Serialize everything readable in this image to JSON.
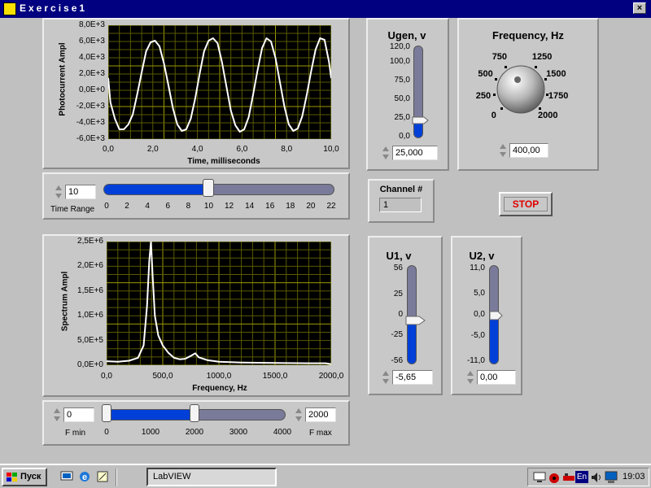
{
  "window": {
    "title": "Exercise1",
    "close": "×"
  },
  "time_graph": {
    "ylabel": "Photocurrent Ampl",
    "xlabel": "Time, milliseconds",
    "yticks": [
      "8,0E+3",
      "6,0E+3",
      "4,0E+3",
      "2,0E+3",
      "0,0E+0",
      "-2,0E+3",
      "-4,0E+3",
      "-6,0E+3"
    ],
    "xticks": [
      "0,0",
      "2,0",
      "4,0",
      "6,0",
      "8,0",
      "10,0"
    ]
  },
  "time_range": {
    "label": "Time Range",
    "value": "10",
    "ticks": [
      "0",
      "2",
      "4",
      "6",
      "8",
      "10",
      "12",
      "14",
      "16",
      "18",
      "20",
      "22"
    ],
    "level": 10
  },
  "spectrum_graph": {
    "ylabel": "Spectrum Ampl",
    "xlabel": "Frequency, Hz",
    "yticks": [
      "2,5E+6",
      "2,0E+6",
      "1,5E+6",
      "1,0E+6",
      "5,0E+5",
      "0,0E+0"
    ],
    "xticks": [
      "0,0",
      "500,0",
      "1000,0",
      "1500,0",
      "2000,0"
    ]
  },
  "fmin": {
    "label": "F min",
    "value": "0"
  },
  "fmax": {
    "label": "F max",
    "value": "2000"
  },
  "fslider": {
    "ticks": [
      "0",
      "1000",
      "2000",
      "3000",
      "4000"
    ],
    "low": 0,
    "high": 2000
  },
  "ugen": {
    "label": "Ugen, v",
    "ticks": [
      "120,0",
      "100,0",
      "75,0",
      "50,0",
      "25,0",
      "0,0"
    ],
    "value": "25,000",
    "level": 25
  },
  "frequency": {
    "label": "Frequency, Hz",
    "ticks": [
      "0",
      "250",
      "500",
      "750",
      "1250",
      "1500",
      "1750",
      "2000"
    ],
    "value": "400,00"
  },
  "channel": {
    "label": "Channel #",
    "value": "1"
  },
  "stop_label": "STOP",
  "u1": {
    "label": "U1, v",
    "ticks": [
      "56",
      "25",
      "0",
      "-25",
      "-56"
    ],
    "value": "-5,65",
    "level": -5.65
  },
  "u2": {
    "label": "U2, v",
    "ticks": [
      "11,0",
      "5,0",
      "0,0",
      "-5,0",
      "-11,0"
    ],
    "value": "0,00",
    "level": 0
  },
  "taskbar": {
    "start": "Пуск",
    "task": "LabVIEW",
    "lang": "En",
    "clock": "19:03"
  },
  "chart_data": [
    {
      "type": "line",
      "title": "",
      "xlabel": "Time, milliseconds",
      "ylabel": "Photocurrent Ampl",
      "xlim": [
        0,
        10
      ],
      "ylim": [
        -6000,
        8000
      ],
      "grid": true,
      "series": [
        {
          "values": [
            [
              0.0,
              1500
            ],
            [
              0.1,
              -1500
            ],
            [
              0.3,
              -3500
            ],
            [
              0.5,
              -4800
            ],
            [
              0.7,
              -4800
            ],
            [
              0.9,
              -4200
            ],
            [
              1.1,
              -3000
            ],
            [
              1.3,
              -500
            ],
            [
              1.5,
              2200
            ],
            [
              1.7,
              4800
            ],
            [
              1.9,
              5900
            ],
            [
              2.1,
              6100
            ],
            [
              2.3,
              5400
            ],
            [
              2.5,
              3300
            ],
            [
              2.7,
              600
            ],
            [
              2.9,
              -2200
            ],
            [
              3.1,
              -4200
            ],
            [
              3.3,
              -5000
            ],
            [
              3.5,
              -4800
            ],
            [
              3.7,
              -3500
            ],
            [
              3.9,
              -1000
            ],
            [
              4.1,
              2000
            ],
            [
              4.3,
              4800
            ],
            [
              4.5,
              6100
            ],
            [
              4.7,
              6400
            ],
            [
              4.9,
              5800
            ],
            [
              5.1,
              3500
            ],
            [
              5.3,
              500
            ],
            [
              5.5,
              -2500
            ],
            [
              5.7,
              -4300
            ],
            [
              5.9,
              -5100
            ],
            [
              6.1,
              -4800
            ],
            [
              6.3,
              -3300
            ],
            [
              6.5,
              -500
            ],
            [
              6.7,
              2500
            ],
            [
              6.9,
              5200
            ],
            [
              7.1,
              6400
            ],
            [
              7.3,
              6000
            ],
            [
              7.5,
              4000
            ],
            [
              7.7,
              1000
            ],
            [
              7.9,
              -2000
            ],
            [
              8.1,
              -4200
            ],
            [
              8.3,
              -5000
            ],
            [
              8.5,
              -4700
            ],
            [
              8.7,
              -3200
            ],
            [
              8.9,
              -600
            ],
            [
              9.1,
              2300
            ],
            [
              9.3,
              5000
            ],
            [
              9.5,
              6400
            ],
            [
              9.7,
              6200
            ],
            [
              9.9,
              3500
            ],
            [
              10.0,
              1500
            ]
          ]
        }
      ]
    },
    {
      "type": "line",
      "title": "",
      "xlabel": "Frequency, Hz",
      "ylabel": "Spectrum Ampl",
      "xlim": [
        0,
        2000
      ],
      "ylim": [
        0,
        2500000
      ],
      "grid": true,
      "series": [
        {
          "values": [
            [
              0,
              80000
            ],
            [
              100,
              70000
            ],
            [
              200,
              90000
            ],
            [
              280,
              150000
            ],
            [
              330,
              400000
            ],
            [
              360,
              1200000
            ],
            [
              380,
              2100000
            ],
            [
              395,
              2500000
            ],
            [
              410,
              1800000
            ],
            [
              430,
              1000000
            ],
            [
              460,
              600000
            ],
            [
              500,
              400000
            ],
            [
              550,
              250000
            ],
            [
              600,
              150000
            ],
            [
              650,
              120000
            ],
            [
              700,
              130000
            ],
            [
              760,
              200000
            ],
            [
              790,
              240000
            ],
            [
              820,
              160000
            ],
            [
              900,
              100000
            ],
            [
              1000,
              70000
            ],
            [
              1200,
              55000
            ],
            [
              1500,
              45000
            ],
            [
              1800,
              40000
            ],
            [
              1950,
              40000
            ],
            [
              2000,
              20000
            ]
          ]
        }
      ]
    }
  ]
}
